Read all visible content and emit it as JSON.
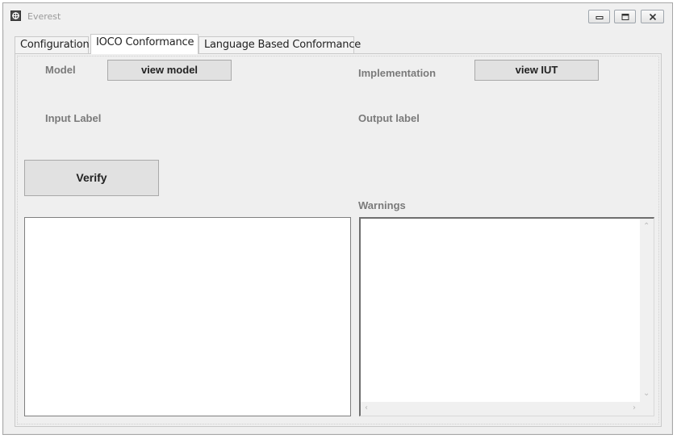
{
  "window": {
    "title": "Everest"
  },
  "tabs": [
    {
      "label": "Configuration"
    },
    {
      "label": "IOCO Conformance"
    },
    {
      "label": "Language Based Conformance"
    }
  ],
  "active_tab": "IOCO Conformance",
  "panel": {
    "model_label": "Model",
    "view_model_button": "view model",
    "implementation_label": "Implementation",
    "view_iut_button": "view IUT",
    "input_label": "Input Label",
    "output_label": "Output label",
    "verify_button": "Verify",
    "warnings_label": "Warnings"
  },
  "icons": {
    "app": "app-icon",
    "minimize": "minimize-icon",
    "maximize": "maximize-icon",
    "close": "close-icon"
  },
  "colors": {
    "label_gray": "#7a7a7a",
    "button_face": "#e1e1e1",
    "window_bg": "#efefef"
  }
}
